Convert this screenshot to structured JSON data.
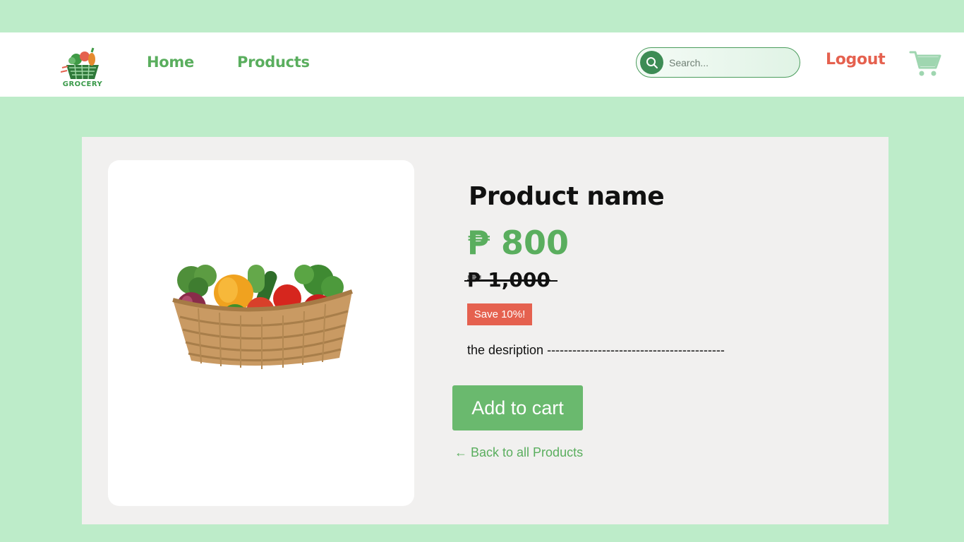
{
  "brand": {
    "logo_text": "GROCERY"
  },
  "nav": {
    "home_label": "Home",
    "products_label": "Products"
  },
  "search": {
    "placeholder": "Search..."
  },
  "account": {
    "logout_label": "Logout"
  },
  "product": {
    "name": "Product name",
    "price": "₱ 800",
    "original_price": "₱ 1,000",
    "discount_badge": "Save 10%!",
    "description": "the desription ------------------------------------------",
    "add_to_cart_label": "Add to cart",
    "back_link_label": "← Back to all Products"
  },
  "icons": {
    "search": "search-icon",
    "cart": "cart-icon",
    "logo": "grocery-basket-logo"
  },
  "colors": {
    "background": "#bdecc9",
    "brand_green": "#5aae5e",
    "button_green": "#6ab96e",
    "accent_red": "#e5614f",
    "card_bg": "#f1f0ef"
  }
}
